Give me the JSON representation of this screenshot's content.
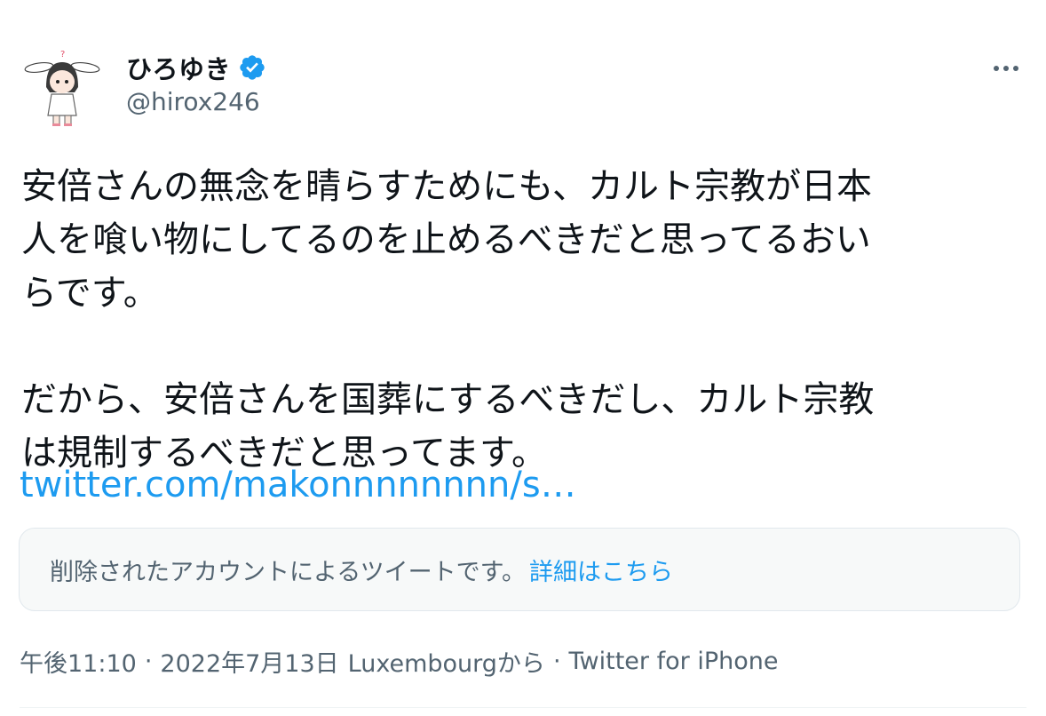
{
  "author": {
    "display_name": "ひろゆき",
    "handle": "@hirox246",
    "verified_icon": "verified-badge-icon",
    "avatar_icon": "bunny-eared-character-avatar"
  },
  "menu": {
    "more_icon": "more-options-icon"
  },
  "tweet": {
    "text": "安倍さんの無念を晴らすためにも、カルト宗教が日本\n人を喰い物にしてるのを止めるべきだと思ってるおい\nらです。\n\nだから、安倍さんを国葬にするべきだし、カルト宗教\nは規制するべきだと思ってます。",
    "link": "twitter.com/makonnnnnnnn/s…"
  },
  "quote": {
    "text": "削除されたアカウントによるツイートです。",
    "link_label": "詳細はこちら"
  },
  "meta": {
    "time": "午後11:10",
    "date": "2022年7月13日",
    "location": "Luxembourgから",
    "source": "Twitter for iPhone",
    "separator": "·"
  },
  "colors": {
    "accent": "#1d9bf0",
    "text": "#0f1419",
    "secondary": "#536471",
    "quote_bg": "#f7f9f9",
    "border": "#e1e8ed"
  }
}
